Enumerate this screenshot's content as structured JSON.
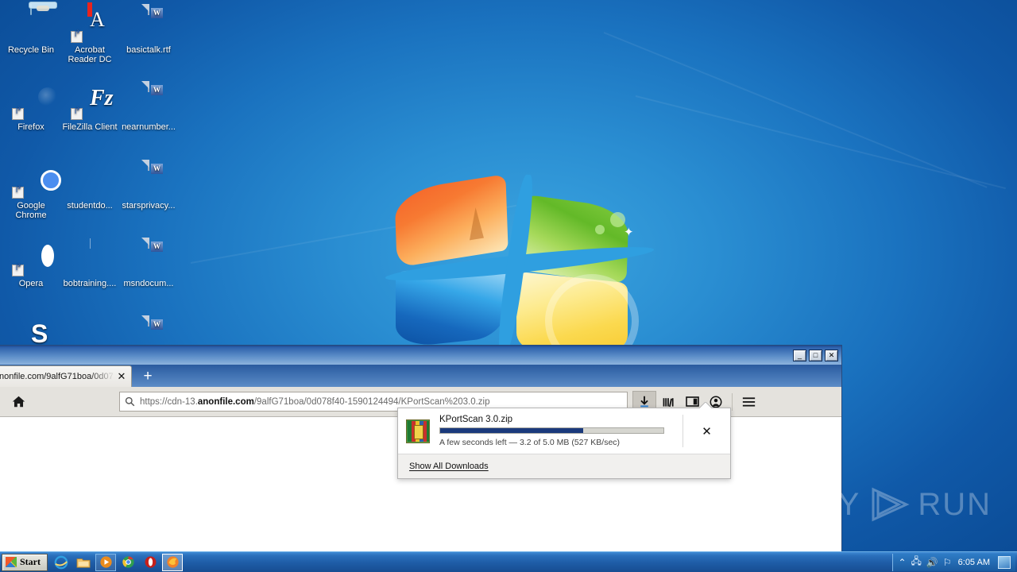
{
  "desktop": {
    "icons": [
      {
        "label": "Recycle Bin",
        "icon": "recycle-bin-icon",
        "shortcut": false
      },
      {
        "label": "Acrobat Reader DC",
        "icon": "acrobat-reader-icon",
        "shortcut": true
      },
      {
        "label": "basictalk.rtf",
        "icon": "word-document-icon",
        "shortcut": false
      },
      {
        "label": "Firefox",
        "icon": "firefox-icon",
        "shortcut": true
      },
      {
        "label": "FileZilla Client",
        "icon": "filezilla-icon",
        "shortcut": true
      },
      {
        "label": "nearnumber...",
        "icon": "word-document-icon",
        "shortcut": false
      },
      {
        "label": "Google Chrome",
        "icon": "chrome-icon",
        "shortcut": true
      },
      {
        "label": "studentdo...",
        "icon": "black-box-icon",
        "shortcut": false
      },
      {
        "label": "starsprivacy...",
        "icon": "word-document-icon",
        "shortcut": false
      },
      {
        "label": "Opera",
        "icon": "opera-icon",
        "shortcut": true
      },
      {
        "label": "bobtraining....",
        "icon": "blank-file-icon",
        "shortcut": false
      },
      {
        "label": "msndocum...",
        "icon": "word-document-icon",
        "shortcut": false
      },
      {
        "label": "",
        "icon": "skype-icon",
        "shortcut": false
      },
      {
        "label": "",
        "icon": "word-document-icon",
        "shortcut": false
      }
    ]
  },
  "browser": {
    "window_controls": {
      "minimize": "_",
      "maximize": "□",
      "close": "✕"
    },
    "tab": {
      "title": "nonfile.com/9alfG71boa/0d07",
      "close_label": "✕"
    },
    "new_tab_label": "+",
    "home_icon": "home-icon",
    "url": {
      "scheme": "https://",
      "subdomain": "cdn-13.",
      "domain": "anonfile.com",
      "path": "/9alfG71boa/0d078f40-1590124494/KPortScan%203.0.zip",
      "full": "https://cdn-13.anonfile.com/9alfG71boa/0d078f40-1590124494/KPortScan%203.0.zip",
      "search_icon": "search-icon"
    },
    "toolbar_buttons": [
      {
        "name": "downloads-button",
        "icon": "download-arrow-icon",
        "active": true
      },
      {
        "name": "library-button",
        "icon": "library-icon",
        "active": false
      },
      {
        "name": "sidebar-button",
        "icon": "sidebar-icon",
        "active": false
      },
      {
        "name": "account-button",
        "icon": "account-icon",
        "active": false
      },
      {
        "name": "menu-button",
        "icon": "hamburger-menu-icon",
        "active": false
      }
    ]
  },
  "download_panel": {
    "file_icon": "winrar-archive-icon",
    "file_name": "KPortScan 3.0.zip",
    "status": "A few seconds left — 3.2 of 5.0 MB (527 KB/sec)",
    "progress_percent": 64,
    "progress_color": "#1b3a7c",
    "cancel_label": "✕",
    "footer_label": "Show All Downloads"
  },
  "watermark": {
    "text_left": "ANY",
    "text_right": "RUN",
    "logo": "play-triangle-icon"
  },
  "taskbar": {
    "start_label": "Start",
    "start_icon": "windows-flag-icon",
    "quick_launch": [
      {
        "name": "internet-explorer-icon",
        "label": "e",
        "state": "normal"
      },
      {
        "name": "windows-explorer-icon",
        "label": "▤",
        "state": "normal"
      },
      {
        "name": "media-player-icon",
        "label": "▶",
        "state": "framed"
      },
      {
        "name": "chrome-taskbar-icon",
        "label": "◉",
        "state": "normal"
      },
      {
        "name": "opera-taskbar-icon",
        "label": "O",
        "state": "normal"
      },
      {
        "name": "firefox-taskbar-icon",
        "label": "◍",
        "state": "current"
      }
    ],
    "tray": {
      "icons": [
        {
          "name": "show-hidden-icons-icon",
          "glyph": "⌃"
        },
        {
          "name": "network-icon",
          "glyph": "🖧"
        },
        {
          "name": "volume-icon",
          "glyph": "🔊"
        },
        {
          "name": "action-center-flag-icon",
          "glyph": "⚐"
        }
      ],
      "clock": "6:05 AM"
    }
  }
}
